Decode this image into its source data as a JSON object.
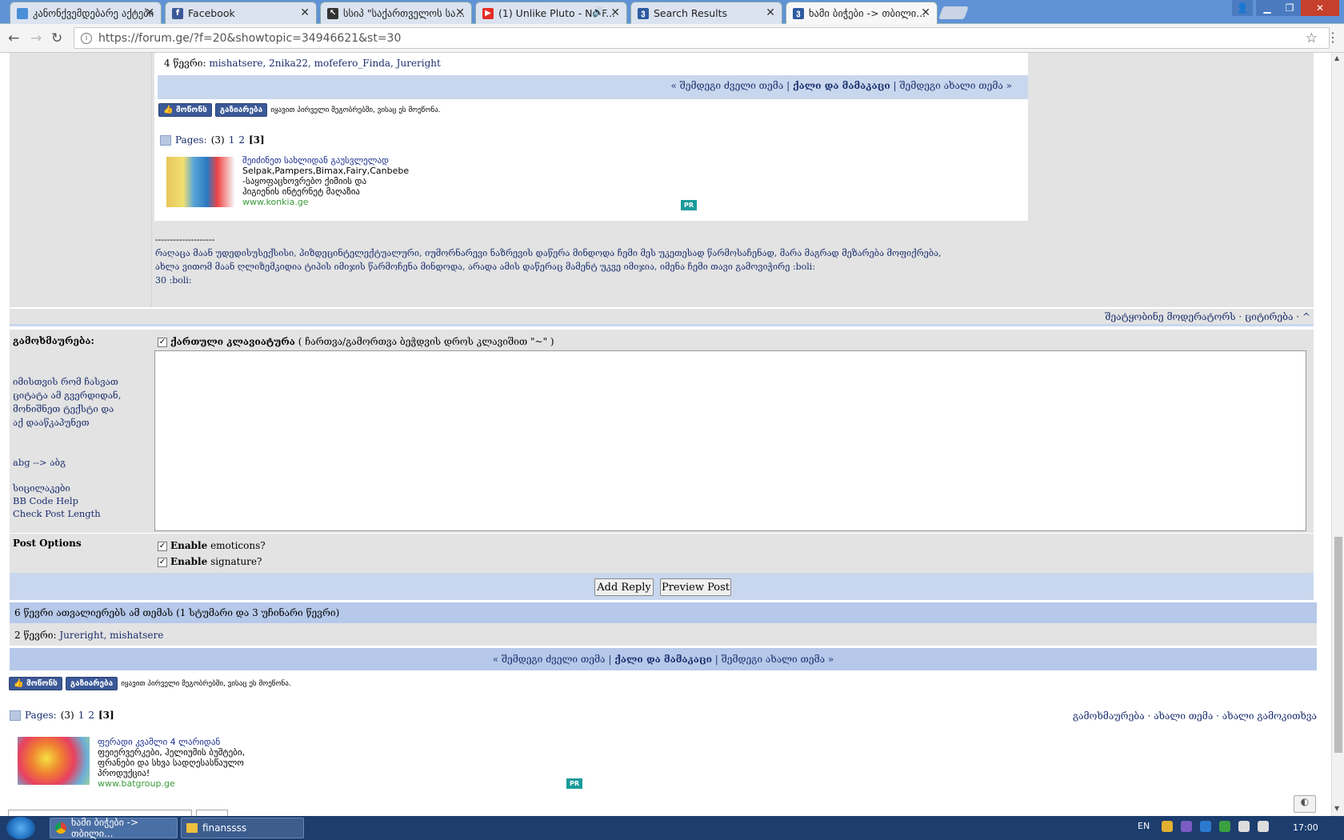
{
  "browser": {
    "tabs": [
      {
        "label": "კანონქვემდებარე აქტები",
        "color": "#4a8fd9"
      },
      {
        "label": "Facebook",
        "color": "#3b5998"
      },
      {
        "label": "სსიპ \"საქართველოს სა...",
        "color": "#333333"
      },
      {
        "label": "(1) Unlike Pluto - No F...",
        "color": "#e52d27"
      },
      {
        "label": "Search Results",
        "color": "#2d5aa0"
      },
      {
        "label": "ხამი ბიჭები -> თბილი...",
        "color": "#2d5aa0"
      }
    ],
    "url": "https://forum.ge/?f=20&showtopic=34946621&st=30"
  },
  "post": {
    "readers_label": "4 წევრი:",
    "readers": "mishatsere, 2nika22, mofefero_Finda, Jureright",
    "nav_prev": "« შემდეგი ძველი თემა",
    "nav_current": "ქალი და მამაკაცი",
    "nav_next": "შემდეგი ახალი თემა »",
    "like_label": "მოწონს",
    "share_label": "გაზიარება",
    "like_text": "იყავით პირველი მეგობრებში, ვისაც ეს მოეწონა.",
    "pages_label": "Pages:",
    "pages_count": "(3)",
    "page1": "1",
    "page2": "2",
    "page3": "[3]",
    "ad1": {
      "title": "შეიძინეთ სახლიდან გაუსვლელად",
      "line1": "Selpak,Pampers,Bimax,Fairy,Canbebe",
      "line2": "-საყოფაცხოვრებო ქიმიის და",
      "line3": "ჰიგიენის ინტერნეტ მაღაზია",
      "url": "www.konkia.ge",
      "badge": "PR"
    },
    "sig_dashes": "--------------------",
    "sig_line1": "რაღაცა მაან უდედისუსექსისი, პიზდეცინტელექტუალური, იუმორნარევი ნაზრევის დაწერა მინდოდა ჩემი მეს უკეთესად წარმოსაჩენად, მარა მაგრად მეზარება მოფიქრება,",
    "sig_line2": "ახლა ვითომ მაან ღლიზემკიდია ტიპის იმიჯის წარმოჩენა მინდოდა, არადა ამის დაწერაც მამენტ უკვე იმიჯია, იმენა ჩემი თავი გამოვიჭირე :boli:",
    "sig_line3": "30 :boli:",
    "report": "შეატყობინე მოდერატორს",
    "quote": "· ციტირება · ^"
  },
  "reply": {
    "label": "გამოხმაურება:",
    "help1": "იმისთვის რომ ჩასვათ",
    "help2": "ციტატა ამ გვერდიდან,",
    "help3": "მონიშნეთ ტექსტი და",
    "help4": "აქ დააწკაპუნეთ",
    "abg": "abg --> აბგ",
    "smilies": "სიცილაკები",
    "bbcode": "BB Code Help",
    "check_len": "Check Post Length",
    "kbd_label": "ქართული კლავიატურა",
    "kbd_hint": "( ჩართვა/გამორთვა ბეჭდვის დროს კლავიშით \"~\" )",
    "options_label": "Post Options",
    "enable1_bold": "Enable",
    "enable1_rest": "emoticons?",
    "enable2_bold": "Enable",
    "enable2_rest": "signature?",
    "add_reply": "Add Reply",
    "preview": "Preview Post"
  },
  "bottom": {
    "active_line": "6 წევრი ათვალიერებს ამ თემას (1 სტუმარი და 3 უჩინარი წევრი)",
    "members_label": "2 წევრი:",
    "members": "Jureright, mishatsere",
    "nav_prev": "« შემდეგი ძველი თემა",
    "nav_current": "ქალი და მამაკაცი",
    "nav_next": "შემდეგი ახალი თემა »",
    "like_label": "მოწონს",
    "share_label": "გაზიარება",
    "like_text": "იყავით პირველი მეგობრებში, ვისაც ეს მოეწონა.",
    "pages_label": "Pages:",
    "pages_count": "(3)",
    "page1": "1",
    "page2": "2",
    "page3": "[3]",
    "actions": "გამოხმაურება · ახალი თემა · ახალი გამოკითხვა",
    "ad2": {
      "title": "ფერადი კვამლი 4 ლარიდან",
      "line1": "ფეიერვერკები, ჰელიუმის ბუშტები,",
      "line2": "ფრანები და სხვა სადღესასწაულო",
      "line3": "პროდუქცია!",
      "url": "www.batgroup.ge",
      "badge": "PR"
    }
  },
  "taskbar": {
    "item1": "ხამი ბიჭები -> თბილი...",
    "item2": "finanssss",
    "lang": "EN",
    "time": "17:00"
  }
}
